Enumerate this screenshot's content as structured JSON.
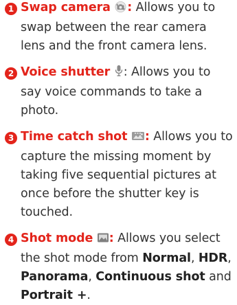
{
  "items": [
    {
      "number": "1",
      "title": "Swap camera",
      "icon": "swap-camera-icon",
      "colon": ":",
      "text": " Allows you to swap between the rear camera lens and the front camera lens."
    },
    {
      "number": "2",
      "title": "Voice shutter",
      "icon": "microphone-icon",
      "colon": ":",
      "text": " Allows you to say voice commands to take a photo."
    },
    {
      "number": "3",
      "title": "Time catch shot",
      "icon": "time-catch-shot-icon",
      "colon": ":",
      "text": " Allows you to capture the missing moment by taking five sequential pictures at once before the shutter key is touched."
    },
    {
      "number": "4",
      "title": "Shot mode",
      "icon": "shot-mode-icon",
      "colon": ":",
      "text_before": " Allows you select the shot mode from ",
      "modes": [
        "Normal",
        "HDR",
        "Panorama",
        "Continuous shot",
        "Portrait +"
      ],
      "sep_comma": ", ",
      "sep_and": " and ",
      "end": "."
    }
  ],
  "colors": {
    "accent": "#e3241b",
    "text": "#333333",
    "icon_gray": "#8a8a8a"
  }
}
